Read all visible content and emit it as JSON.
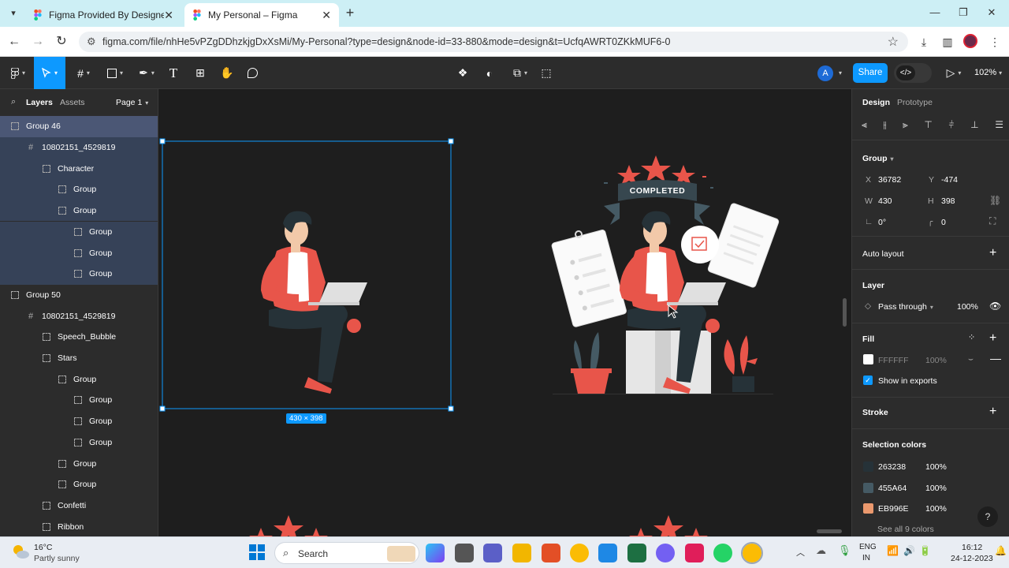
{
  "browser": {
    "tabs": [
      {
        "label": "Figma Provided By Designer – F",
        "active": false
      },
      {
        "label": "My Personal – Figma",
        "active": true
      }
    ],
    "url": "figma.com/file/nhHe5vPZgDDhzkjgDxXsMi/My-Personal?type=design&node-id=33-880&mode=design&t=UcfqAWRT0ZKkMUF6-0"
  },
  "toolbar": {
    "avatar_initial": "A",
    "share_label": "Share",
    "zoom": "102%"
  },
  "layers_panel": {
    "tabs": {
      "layers": "Layers",
      "assets": "Assets"
    },
    "page": "Page 1",
    "items": [
      {
        "label": "Group 46",
        "depth": 0,
        "kind": "group",
        "selected": true
      },
      {
        "label": "10802151_4529819",
        "depth": 1,
        "kind": "frame",
        "selected": true
      },
      {
        "label": "Character",
        "depth": 2,
        "kind": "group",
        "selected": true
      },
      {
        "label": "Group",
        "depth": 3,
        "kind": "group",
        "selected": true
      },
      {
        "label": "Group",
        "depth": 3,
        "kind": "group",
        "selected": true
      },
      {
        "label": "Group",
        "depth": 4,
        "kind": "group",
        "selected": true
      },
      {
        "label": "Group",
        "depth": 4,
        "kind": "group",
        "selected": true
      },
      {
        "label": "Group",
        "depth": 4,
        "kind": "group",
        "selected": true
      },
      {
        "label": "Group 50",
        "depth": 0,
        "kind": "group",
        "selected": false
      },
      {
        "label": "10802151_4529819",
        "depth": 1,
        "kind": "frame",
        "selected": false
      },
      {
        "label": "Speech_Bubble",
        "depth": 2,
        "kind": "group",
        "selected": false
      },
      {
        "label": "Stars",
        "depth": 2,
        "kind": "group",
        "selected": false
      },
      {
        "label": "Group",
        "depth": 3,
        "kind": "group",
        "selected": false
      },
      {
        "label": "Group",
        "depth": 4,
        "kind": "group",
        "selected": false
      },
      {
        "label": "Group",
        "depth": 4,
        "kind": "group",
        "selected": false
      },
      {
        "label": "Group",
        "depth": 4,
        "kind": "group",
        "selected": false
      },
      {
        "label": "Group",
        "depth": 3,
        "kind": "group",
        "selected": false
      },
      {
        "label": "Group",
        "depth": 3,
        "kind": "group",
        "selected": false
      },
      {
        "label": "Confetti",
        "depth": 2,
        "kind": "group",
        "selected": false
      },
      {
        "label": "Ribbon",
        "depth": 2,
        "kind": "group",
        "selected": false
      }
    ]
  },
  "canvas": {
    "selection_size": "430 × 398",
    "ribbon_text": "COMPLETED"
  },
  "design_panel": {
    "tabs": {
      "design": "Design",
      "prototype": "Prototype"
    },
    "layer_type": "Group",
    "x_label": "X",
    "x": "36782",
    "y_label": "Y",
    "y": "-474",
    "w_label": "W",
    "w": "430",
    "h_label": "H",
    "h": "398",
    "rotation": "0°",
    "radius": "0",
    "auto_layout": "Auto layout",
    "layer_section": "Layer",
    "blend_mode": "Pass through",
    "layer_opacity": "100%",
    "fill_section": "Fill",
    "fill_hex": "FFFFFF",
    "fill_opacity": "100%",
    "show_in_exports": "Show in exports",
    "stroke_section": "Stroke",
    "selection_colors_title": "Selection colors",
    "selection_colors": [
      {
        "hex": "263238",
        "opacity": "100%",
        "color": "#263238"
      },
      {
        "hex": "455A64",
        "opacity": "100%",
        "color": "#455a64"
      },
      {
        "hex": "EB996E",
        "opacity": "100%",
        "color": "#eb996e"
      }
    ],
    "see_all": "See all 9 colors",
    "help": "?"
  },
  "taskbar": {
    "weather_temp": "16°C",
    "weather_desc": "Partly sunny",
    "search_label": "Search",
    "lang_top": "ENG",
    "lang_bottom": "IN",
    "time": "16:12",
    "date": "24-12-2023"
  }
}
